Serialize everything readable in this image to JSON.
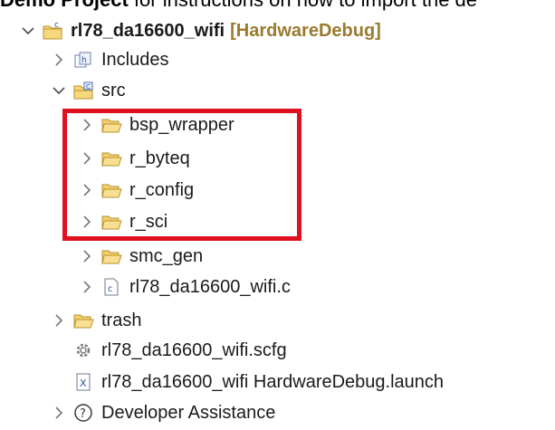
{
  "top_text": {
    "bold": "Demo Project",
    "rest": " for instructions on how to import the de"
  },
  "project": {
    "name": "rl78_da16600_wifi",
    "config": "[HardwareDebug]"
  },
  "tree": {
    "includes": "Includes",
    "src": "src",
    "bsp_wrapper": "bsp_wrapper",
    "r_byteq": "r_byteq",
    "r_config": "r_config",
    "r_sci": "r_sci",
    "smc_gen": "smc_gen",
    "c_file": "rl78_da16600_wifi.c",
    "trash": "trash",
    "scfg_file": "rl78_da16600_wifi.scfg",
    "launch_file": "rl78_da16600_wifi HardwareDebug.launch",
    "developer_assistance": "Developer Assistance"
  },
  "icons": {
    "expanded": "chevron-down-icon",
    "collapsed": "chevron-right-icon",
    "folder": "folder-icon",
    "c_file": "c-file-icon",
    "scfg": "gear-icon",
    "launch": "launch-file-icon",
    "help": "help-icon"
  },
  "colors": {
    "highlight_box": "#e0101e",
    "decoration": "#9a7b2e"
  }
}
